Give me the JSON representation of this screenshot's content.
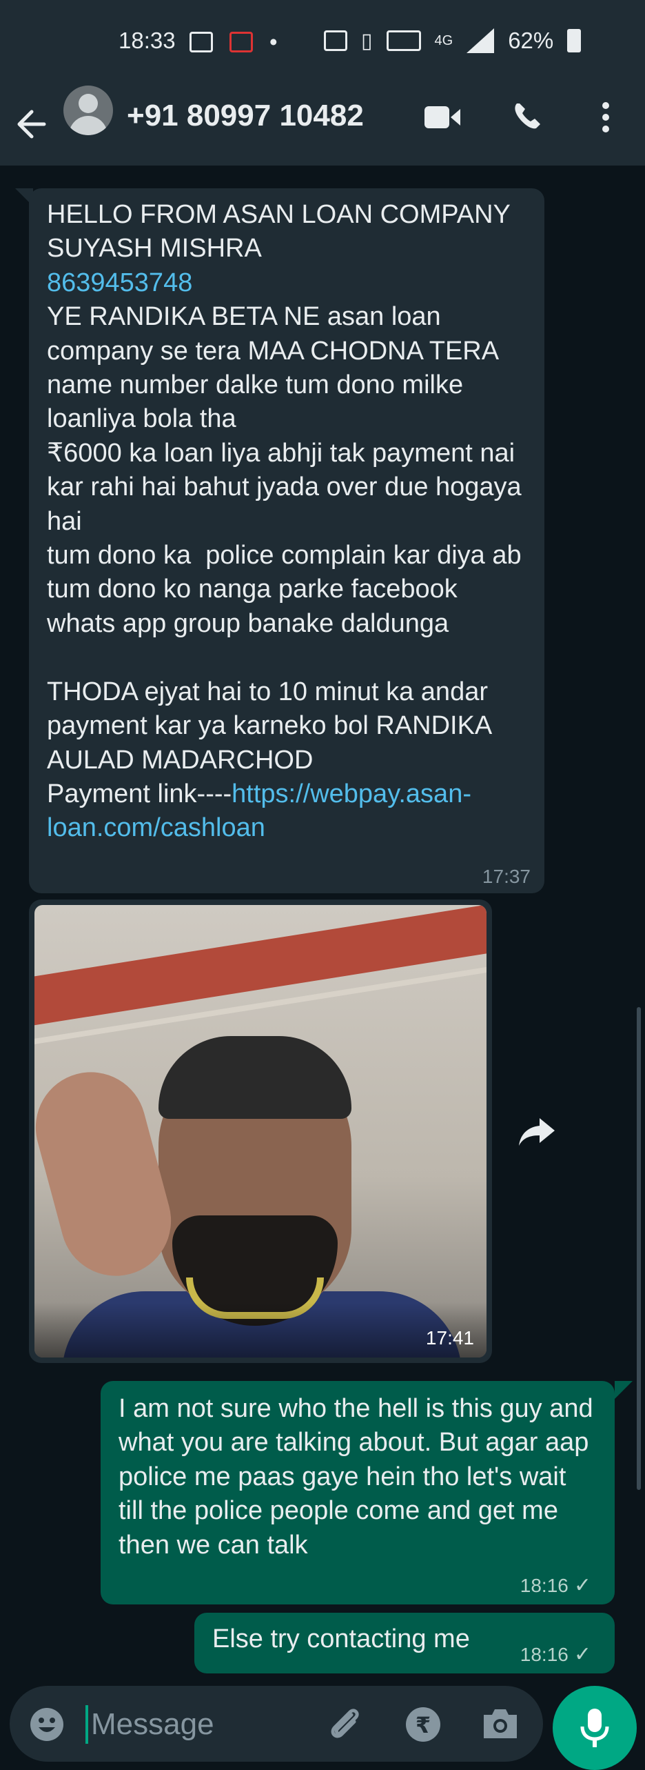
{
  "status_bar": {
    "time": "18:33",
    "network": "4G",
    "battery": "62%"
  },
  "header": {
    "back_icon": "back-arrow-icon",
    "contact_name": "+91 80997 10482",
    "actions": [
      "video-call-icon",
      "voice-call-icon",
      "more-options-icon"
    ]
  },
  "messages": [
    {
      "direction": "incoming",
      "text_before_link": "HELLO FROM ASAN LOAN COMPANY\nSUYASH MISHRA\n",
      "phone_link": "8639453748",
      "text_after_phone": "\nYE RANDIKA BETA NE asan loan company se tera MAA CHODNA TERA   name number dalke tum dono milke loanliya bola tha\n₹6000 ka loan liya abhji tak payment nai kar rahi hai bahut jyada over due hogaya hai\ntum dono ka  police complain kar diya ab tum dono ko nanga parke facebook whats app group banake daldunga\n\nTHODA ejyat hai to 10 minut ka andar payment kar ya karneko bol RANDIKA AULAD MADARCHOD\nPayment link----",
      "url_link": "https://webpay.asan-loan.com/cashloan",
      "time": "17:37"
    },
    {
      "direction": "incoming",
      "type": "image",
      "time": "17:41"
    },
    {
      "direction": "outgoing",
      "text": "I am not sure who the hell is this guy and what you are talking about. But agar aap police me paas gaye hein tho let's wait till the police people come and get me then we can talk",
      "time": "18:16",
      "status": "✓"
    },
    {
      "direction": "outgoing",
      "text": "Else try contacting me",
      "time": "18:16",
      "status": "✓"
    }
  ],
  "composer": {
    "placeholder": "Message",
    "icons": [
      "emoji-icon",
      "attachment-icon",
      "rupee-payment-icon",
      "camera-icon",
      "microphone-icon"
    ]
  },
  "colors": {
    "header_bg": "#1f2c34",
    "chat_bg": "#0b141a",
    "incoming_bubble": "#1f2c34",
    "outgoing_bubble": "#005c4b",
    "accent": "#00a884",
    "link": "#53bdeb"
  }
}
